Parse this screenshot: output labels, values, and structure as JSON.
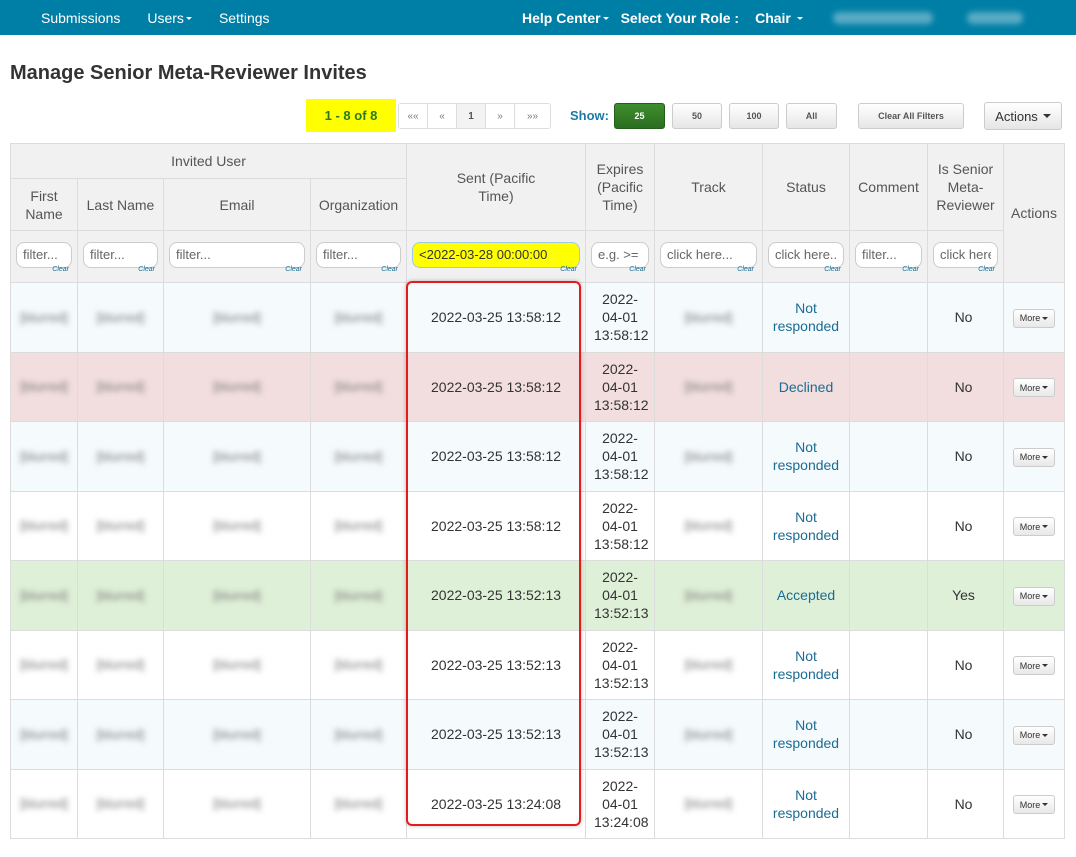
{
  "navbar": {
    "left_items": [
      {
        "label": "Submissions",
        "has_caret": false
      },
      {
        "label": "Users",
        "has_caret": true
      },
      {
        "label": "Settings",
        "has_caret": false
      }
    ],
    "help_center": "Help Center",
    "role_label": "Select Your Role :",
    "role_value": "Chair",
    "background_color": "#007fa6"
  },
  "page": {
    "title": "Manage Senior Meta-Reviewer Invites"
  },
  "toolbar": {
    "count_label": "1 - 8 of 8",
    "pager": [
      "««",
      "«",
      "1",
      "»",
      "»»"
    ],
    "pager_active": "1",
    "show_label": "Show:",
    "page_sizes": [
      "25",
      "50",
      "100",
      "All"
    ],
    "page_size_selected": "25",
    "clear_filters_label": "Clear All Filters",
    "actions_label": "Actions"
  },
  "table": {
    "group_header": "Invited User",
    "columns": {
      "first_name": "First Name",
      "last_name": "Last Name",
      "email": "Email",
      "organization": "Organization",
      "sent": "Sent (Pacific Time)",
      "expires": "Expires (Pacific Time)",
      "track": "Track",
      "status": "Status",
      "comment": "Comment",
      "is_senior": "Is Senior Meta-Reviewer",
      "actions": "Actions"
    },
    "filters": {
      "first_name": {
        "placeholder": "filter...",
        "value": ""
      },
      "last_name": {
        "placeholder": "filter...",
        "value": ""
      },
      "email": {
        "placeholder": "filter...",
        "value": ""
      },
      "organization": {
        "placeholder": "filter...",
        "value": ""
      },
      "sent": {
        "placeholder": "",
        "value": "<2022-03-28 00:00:00"
      },
      "expires": {
        "placeholder": "e.g. >=",
        "value": ""
      },
      "track": {
        "placeholder": "click here...",
        "value": ""
      },
      "status": {
        "placeholder": "click here...",
        "value": ""
      },
      "comment": {
        "placeholder": "filter...",
        "value": ""
      },
      "is_senior": {
        "placeholder": "click here...",
        "value": ""
      },
      "clear_label": "Clear"
    },
    "more_label": "More",
    "rows": [
      {
        "style": "info",
        "first": "[blurred]",
        "last": "[blurred]",
        "email": "[blurred]",
        "org": "[blurred]",
        "sent": "2022-03-25 13:58:12",
        "expires": "2022-04-01 13:58:12",
        "track": "[blurred]",
        "status": "Not responded",
        "comment": "",
        "is_senior": "No"
      },
      {
        "style": "declined",
        "first": "[blurred]",
        "last": "[blurred]",
        "email": "[blurred]",
        "org": "[blurred]",
        "sent": "2022-03-25 13:58:12",
        "expires": "2022-04-01 13:58:12",
        "track": "[blurred]",
        "status": "Declined",
        "comment": "",
        "is_senior": "No"
      },
      {
        "style": "info",
        "first": "[blurred]",
        "last": "[blurred]",
        "email": "[blurred]",
        "org": "[blurred]",
        "sent": "2022-03-25 13:58:12",
        "expires": "2022-04-01 13:58:12",
        "track": "[blurred]",
        "status": "Not responded",
        "comment": "",
        "is_senior": "No"
      },
      {
        "style": "white",
        "first": "[blurred]",
        "last": "[blurred]",
        "email": "[blurred]",
        "org": "[blurred]",
        "sent": "2022-03-25 13:58:12",
        "expires": "2022-04-01 13:58:12",
        "track": "[blurred]",
        "status": "Not responded",
        "comment": "",
        "is_senior": "No"
      },
      {
        "style": "accepted",
        "first": "[blurred]",
        "last": "[blurred]",
        "email": "[blurred]",
        "org": "[blurred]",
        "sent": "2022-03-25 13:52:13",
        "expires": "2022-04-01 13:52:13",
        "track": "[blurred]",
        "status": "Accepted",
        "comment": "",
        "is_senior": "Yes"
      },
      {
        "style": "white",
        "first": "[blurred]",
        "last": "[blurred]",
        "email": "[blurred]",
        "org": "[blurred]",
        "sent": "2022-03-25 13:52:13",
        "expires": "2022-04-01 13:52:13",
        "track": "[blurred]",
        "status": "Not responded",
        "comment": "",
        "is_senior": "No"
      },
      {
        "style": "info",
        "first": "[blurred]",
        "last": "[blurred]",
        "email": "[blurred]",
        "org": "[blurred]",
        "sent": "2022-03-25 13:52:13",
        "expires": "2022-04-01 13:52:13",
        "track": "[blurred]",
        "status": "Not responded",
        "comment": "",
        "is_senior": "No"
      },
      {
        "style": "white",
        "first": "[blurred]",
        "last": "[blurred]",
        "email": "[blurred]",
        "org": "[blurred]",
        "sent": "2022-03-25 13:24:08",
        "expires": "2022-04-01 13:24:08",
        "track": "[blurred]",
        "status": "Not responded",
        "comment": "",
        "is_senior": "No"
      }
    ]
  },
  "colors": {
    "count_badge_bg": "#ffff00",
    "highlight_box": "#e51b1b",
    "row_declined": "#f2dede",
    "row_accepted": "#dff0d8",
    "status_text": "#1a6c93",
    "show_size_active": "#2b6e20"
  }
}
